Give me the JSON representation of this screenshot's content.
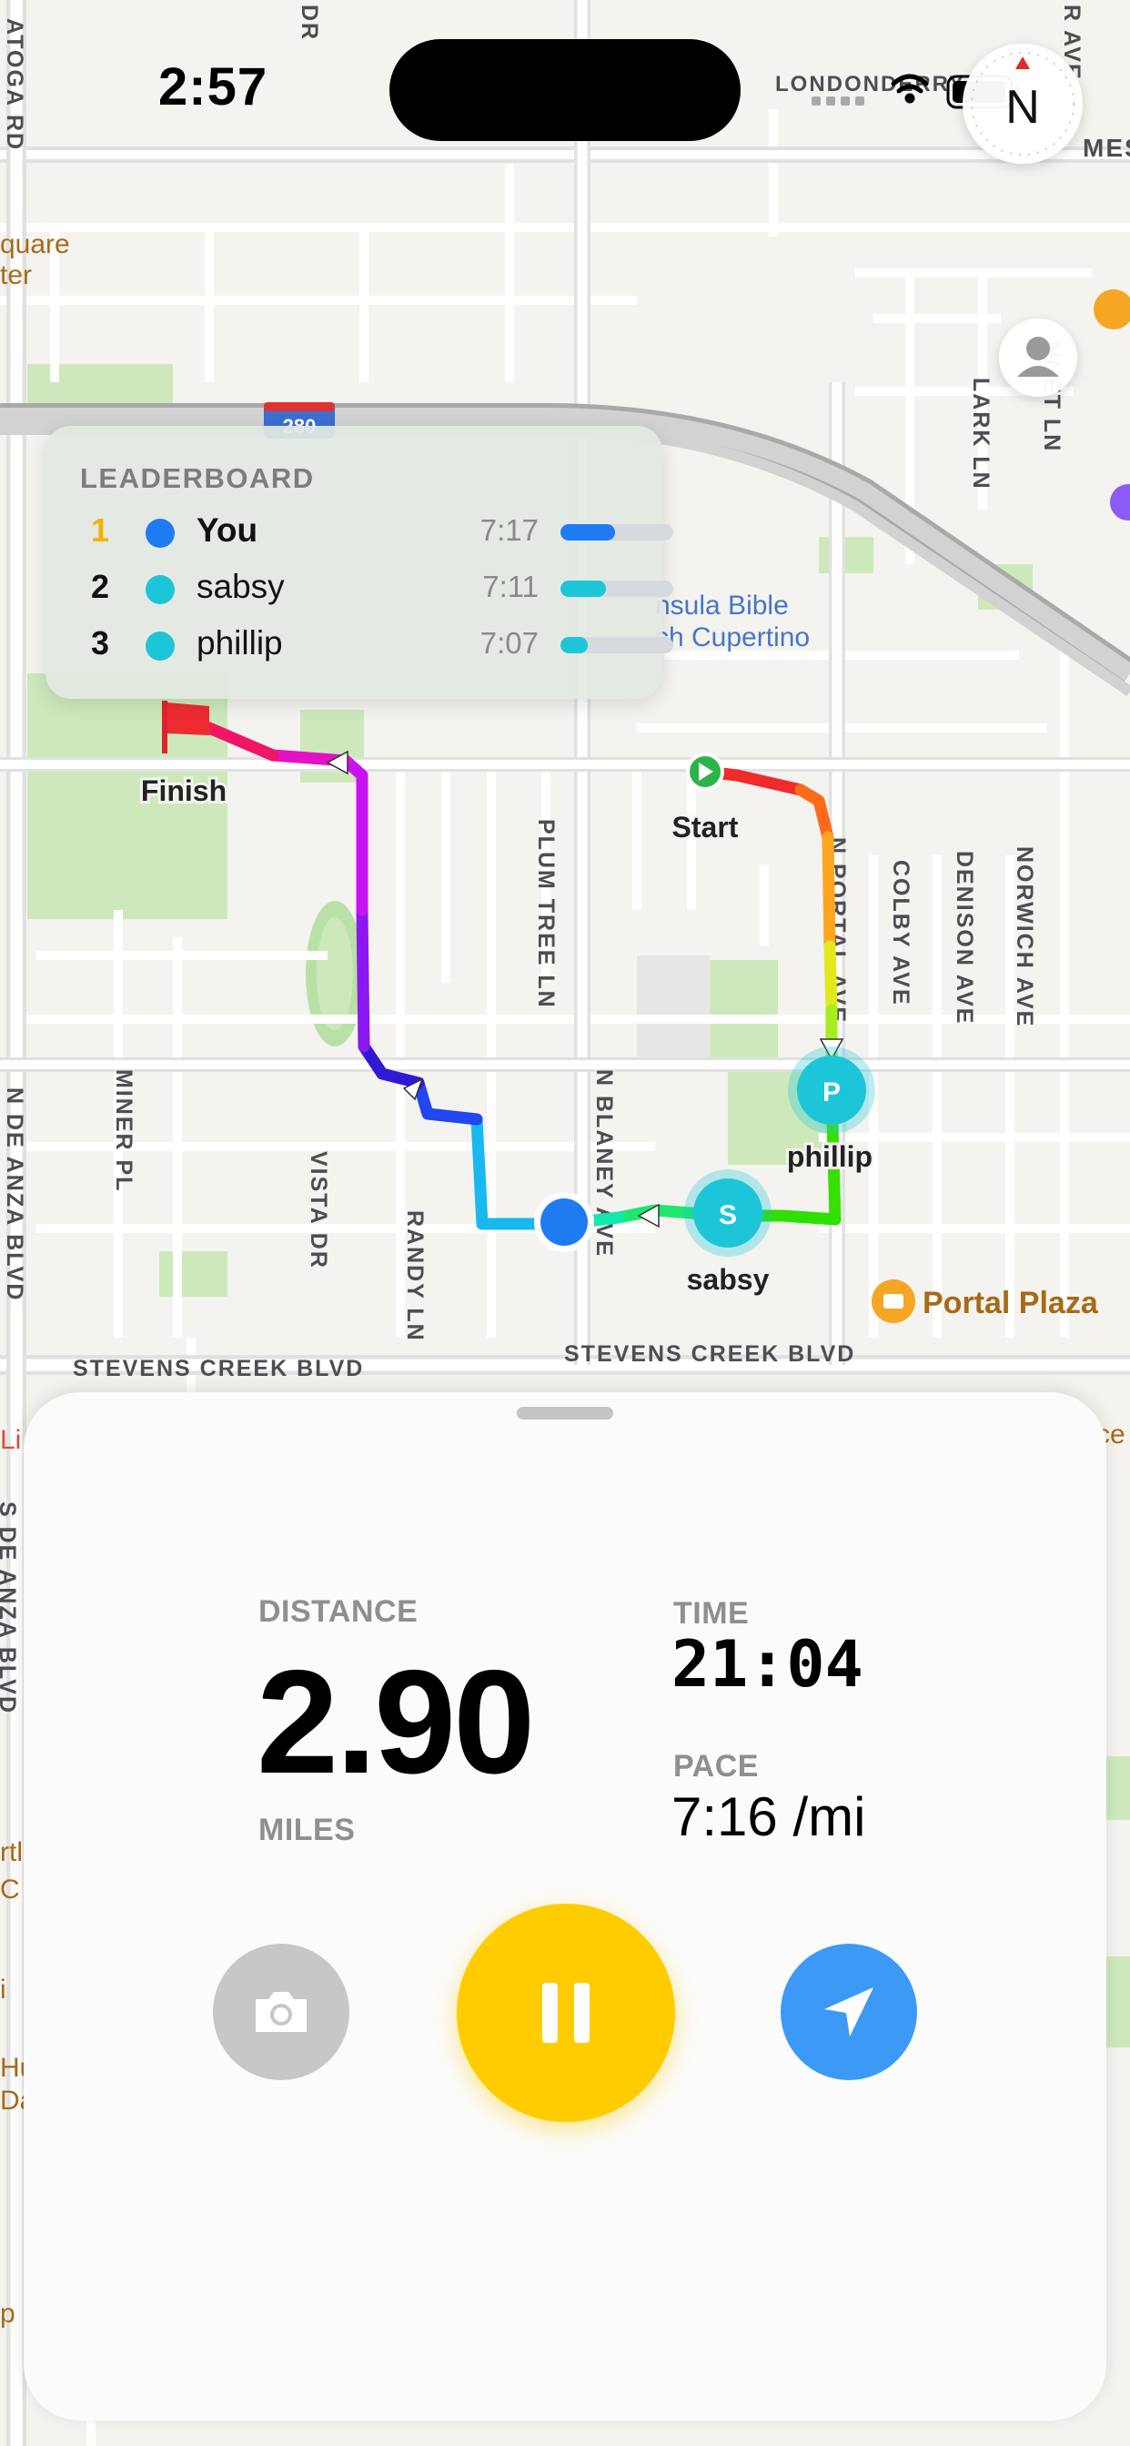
{
  "status_bar": {
    "time": "2:57"
  },
  "compass": {
    "heading_label": "N"
  },
  "leaderboard": {
    "title": "LEADERBOARD",
    "rows": [
      {
        "rank": "1",
        "name": "You",
        "pace": "7:17",
        "color": "#1e7bf2",
        "progress": 0.48
      },
      {
        "rank": "2",
        "name": "sabsy",
        "pace": "7:11",
        "color": "#1cc6d8",
        "progress": 0.4
      },
      {
        "rank": "3",
        "name": "phillip",
        "pace": "7:07",
        "color": "#1cc6d8",
        "progress": 0.24
      }
    ]
  },
  "map": {
    "labels": {
      "finish": "Finish",
      "start": "Start",
      "phillip": "phillip",
      "sabsy": "sabsy",
      "church": "nsula Bible",
      "church2": "ch Cupertino",
      "portal_plaza": "Portal Plaza",
      "stevens_creek_left": "STEVENS CREEK BLVD",
      "stevens_creek_right": "STEVENS CREEK BLVD",
      "n_portal_ave": "N PORTAL AVE",
      "colby_ave": "COLBY AVE",
      "denison_ave": "DENISON AVE",
      "norwich_ave": "NORWICH AVE",
      "plum_tree_ln": "PLUM TREE LN",
      "n_blaney_ave": "N BLANEY AVE",
      "miner_pl": "MINER PL",
      "vista_dr": "VISTA DR",
      "randy_ln": "RANDY LN",
      "n_de_anza_blvd": "N DE ANZA BLVD",
      "s_de_anza_blvd": "S DE ANZA BLVD",
      "lark_ln": "LARK LN",
      "nnet_ln": "NNET LN",
      "londonderry": "LONDONDERRY",
      "saratoga_rd": "ATOGA RD",
      "mest": "MEST",
      "quare": "quare",
      "ter": "ter",
      "i280": "280",
      "r_ave": "R AVE",
      "dr": "DR",
      "li": "Li",
      "ce": "ce",
      "rtl": "rtl",
      "c": "C",
      "i": "i",
      "hu": "Hu",
      "da": "Da",
      "p": "p"
    },
    "runner_initials": {
      "phillip": "P",
      "sabsy": "S"
    }
  },
  "stats": {
    "distance_label": "DISTANCE",
    "distance_value": "2.90",
    "distance_unit": "MILES",
    "time_label": "TIME",
    "time_value": "21:04",
    "pace_label": "PACE",
    "pace_value": "7:16 /mi"
  },
  "controls": {
    "camera_icon": "camera-icon",
    "pause_icon": "pause-icon",
    "locate_icon": "location-arrow-icon"
  },
  "colors": {
    "accent_yellow": "#ffcc00",
    "locate_blue": "#3c9af6",
    "user_blue": "#1e7bf2",
    "friend_cyan": "#1cc6d8"
  }
}
